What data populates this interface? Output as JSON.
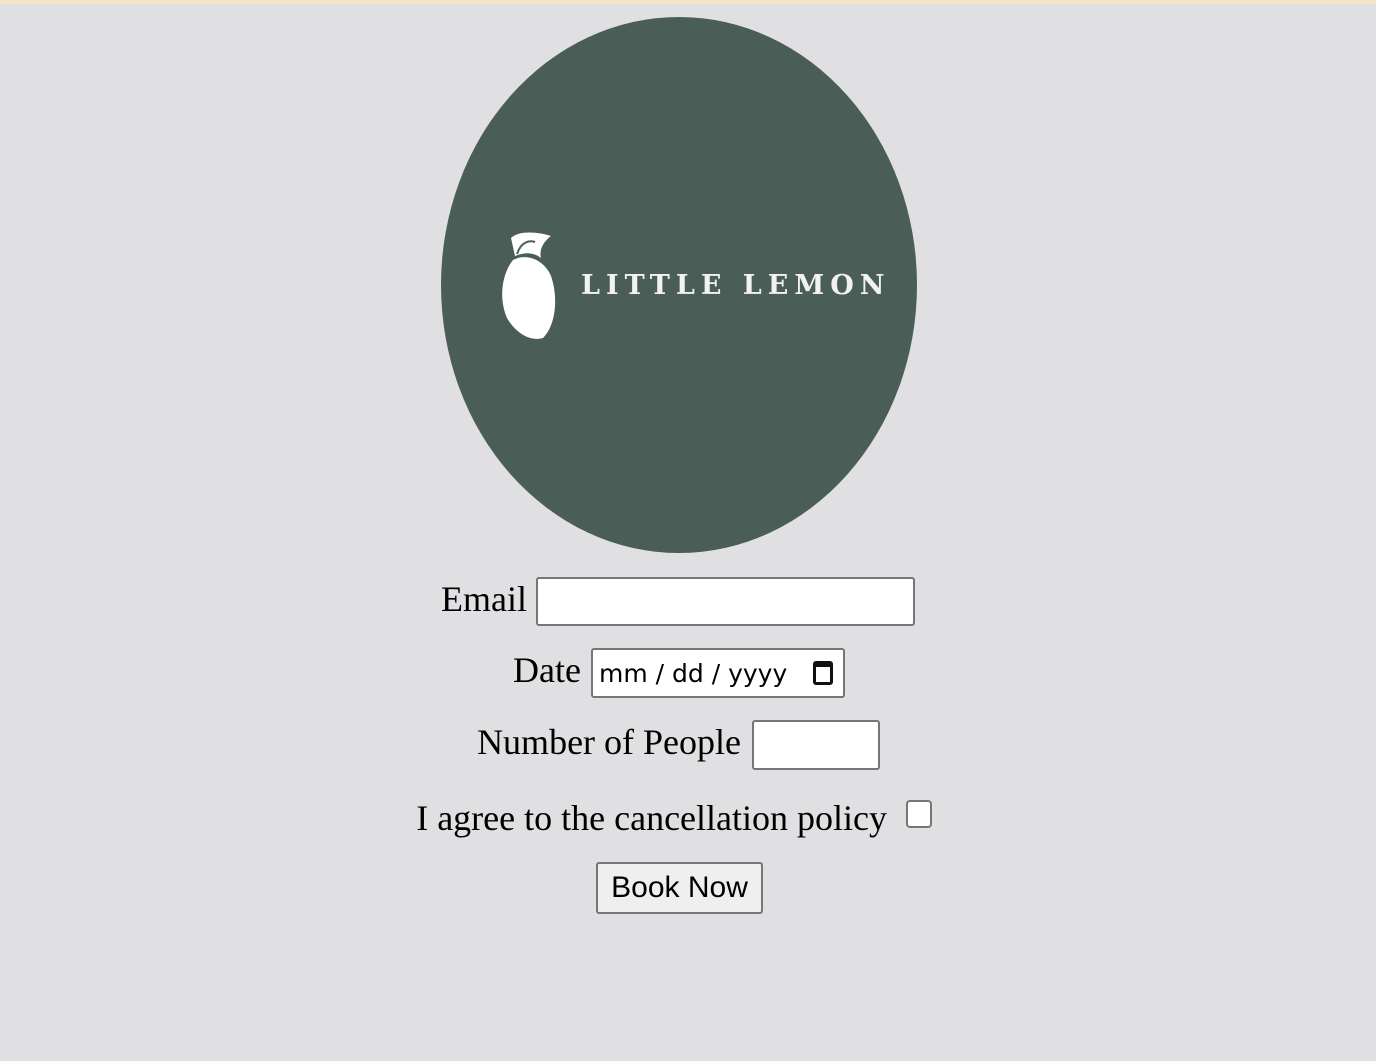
{
  "logo": {
    "brand_text": "LITTLE LEMON",
    "icon": "lemon-icon",
    "bg_color": "#4a5e57"
  },
  "form": {
    "email_label": "Email",
    "email_value": "",
    "date_label": "Date",
    "date_placeholder": "mm / dd / yyyy",
    "people_label": "Number of People",
    "people_value": "",
    "policy_label": "I agree to the cancellation policy",
    "policy_checked": false,
    "submit_label": "Book Now"
  }
}
